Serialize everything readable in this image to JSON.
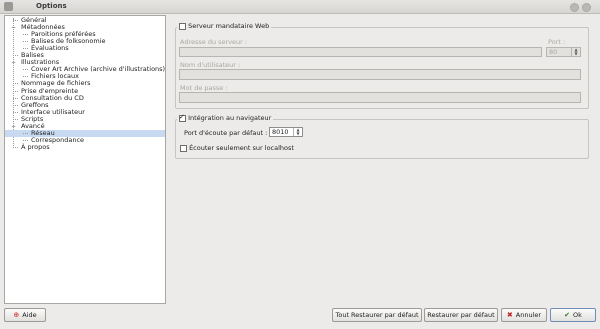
{
  "window": {
    "title": "Options"
  },
  "tree": {
    "items": [
      {
        "label": "Général",
        "level": 0,
        "expander": ""
      },
      {
        "label": "Métadonnées",
        "level": 0,
        "expander": "−"
      },
      {
        "label": "Paroitions préférées",
        "level": 1,
        "expander": ""
      },
      {
        "label": "Balises de folksonomie",
        "level": 1,
        "expander": ""
      },
      {
        "label": "Évaluations",
        "level": 1,
        "expander": ""
      },
      {
        "label": "Balises",
        "level": 0,
        "expander": ""
      },
      {
        "label": "Illustrations",
        "level": 0,
        "expander": "−"
      },
      {
        "label": "Cover Art Archive (archive d'illustrations)",
        "level": 1,
        "expander": ""
      },
      {
        "label": "Fichiers locaux",
        "level": 1,
        "expander": ""
      },
      {
        "label": "Nommage de fichiers",
        "level": 0,
        "expander": ""
      },
      {
        "label": "Prise d'empreinte",
        "level": 0,
        "expander": ""
      },
      {
        "label": "Consultation du CD",
        "level": 0,
        "expander": ""
      },
      {
        "label": "Greffons",
        "level": 0,
        "expander": ""
      },
      {
        "label": "Interface utilisateur",
        "level": 0,
        "expander": ""
      },
      {
        "label": "Scripts",
        "level": 0,
        "expander": ""
      },
      {
        "label": "Avancé",
        "level": 0,
        "expander": "−"
      },
      {
        "label": "Réseau",
        "level": 1,
        "expander": "",
        "selected": true
      },
      {
        "label": "Correspondance",
        "level": 1,
        "expander": ""
      },
      {
        "label": "À propos",
        "level": 0,
        "expander": ""
      }
    ]
  },
  "proxy": {
    "title": "Serveur mandataire Web",
    "checked": false,
    "server_label": "Adresse du serveur :",
    "server_value": "",
    "port_label": "Port :",
    "port_value": "80",
    "user_label": "Nom d'utilisateur :",
    "user_value": "",
    "password_label": "Mot de passe :",
    "password_value": ""
  },
  "browser": {
    "title": "Intégration au navigateur",
    "checked": true,
    "port_label": "Port d'écoute par défaut :",
    "port_value": "8010",
    "localhost_label": "Écouter seulement sur localhost",
    "localhost_checked": false
  },
  "buttons": {
    "help": "Aide",
    "restore_all": "Tout Restaurer par défaut",
    "restore": "Restaurer par défaut",
    "cancel": "Annuler",
    "ok": "Ok"
  },
  "icons": {
    "help": "help-icon",
    "cancel": "cancel-icon",
    "ok": "ok-icon"
  }
}
